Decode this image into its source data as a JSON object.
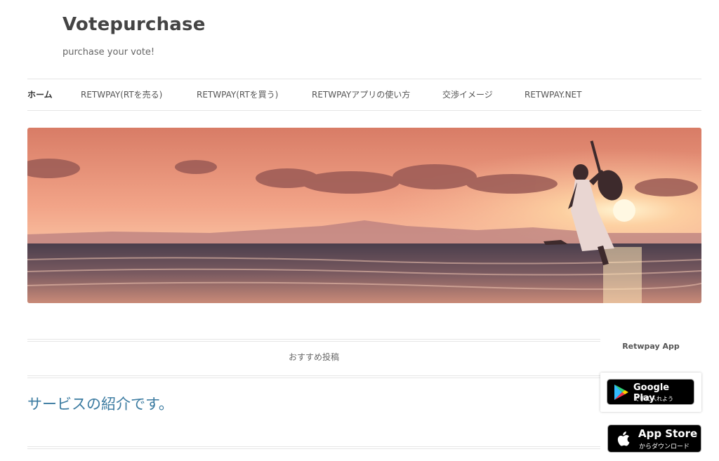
{
  "site": {
    "title": "Votepurchase",
    "tagline": "purchase your vote!"
  },
  "nav": {
    "items": [
      {
        "label": "ホーム",
        "active": true
      },
      {
        "label": "RETWPAY(RTを売る)"
      },
      {
        "label": "RETWPAY(RTを買う)"
      },
      {
        "label": "RETWPAYアプリの使い方"
      },
      {
        "label": "交渉イメージ"
      },
      {
        "label": "RETWPAY.NET"
      }
    ]
  },
  "banner": {
    "image_subject": "sunset-beach-jumping-guitarist",
    "colors": {
      "sky_top": "#e08a70",
      "sky_mid": "#f3a98a",
      "sun": "#fff2c8",
      "sea": "#3a3a4a",
      "sand": "#d9937a"
    }
  },
  "main": {
    "featured_label": "おすすめ投稿",
    "posts": [
      {
        "title": "サービスの紹介です。"
      }
    ]
  },
  "sidebar": {
    "widget_title": "Retwpay App",
    "google_play": {
      "main": "Google Play",
      "sub": "で手に入れよう"
    },
    "app_store": {
      "main": "App Store",
      "sub": "からダウンロード"
    }
  },
  "colors": {
    "accent_link": "#3a7aa0",
    "text": "#444444",
    "border": "#e6e6e6"
  }
}
